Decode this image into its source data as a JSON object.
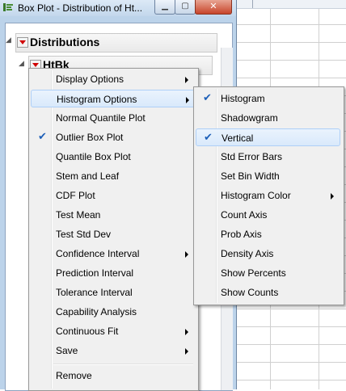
{
  "window": {
    "title": "Box Plot - Distribution of Ht...",
    "controls": {
      "minimize": "▁",
      "maximize": "▢",
      "close": "✕"
    }
  },
  "report": {
    "heading": "Distributions",
    "sub_heading": "HtBk"
  },
  "main_menu": {
    "items": [
      {
        "label": "Display Options",
        "submenu": true
      },
      {
        "label": "Histogram Options",
        "submenu": true,
        "highlighted": true
      },
      {
        "label": "Normal Quantile Plot"
      },
      {
        "label": "Outlier Box Plot",
        "checked": true
      },
      {
        "label": "Quantile Box Plot"
      },
      {
        "label": "Stem and Leaf"
      },
      {
        "label": "CDF Plot"
      },
      {
        "label": "Test Mean"
      },
      {
        "label": "Test Std Dev"
      },
      {
        "label": "Confidence Interval",
        "submenu": true
      },
      {
        "label": "Prediction Interval"
      },
      {
        "label": "Tolerance Interval"
      },
      {
        "label": "Capability Analysis"
      },
      {
        "label": "Continuous Fit",
        "submenu": true
      },
      {
        "label": "Save",
        "submenu": true
      },
      {
        "label": "Remove"
      }
    ]
  },
  "histogram_menu": {
    "items": [
      {
        "label": "Histogram",
        "checked": true
      },
      {
        "label": "Shadowgram"
      },
      {
        "label": "Vertical",
        "checked": true,
        "highlighted": true
      },
      {
        "label": "Std Error Bars"
      },
      {
        "label": "Set Bin Width"
      },
      {
        "label": "Histogram Color",
        "submenu": true
      },
      {
        "label": "Count Axis"
      },
      {
        "label": "Prob Axis"
      },
      {
        "label": "Density Axis"
      },
      {
        "label": "Show Percents"
      },
      {
        "label": "Show Counts"
      }
    ]
  },
  "check_glyph": "✔"
}
